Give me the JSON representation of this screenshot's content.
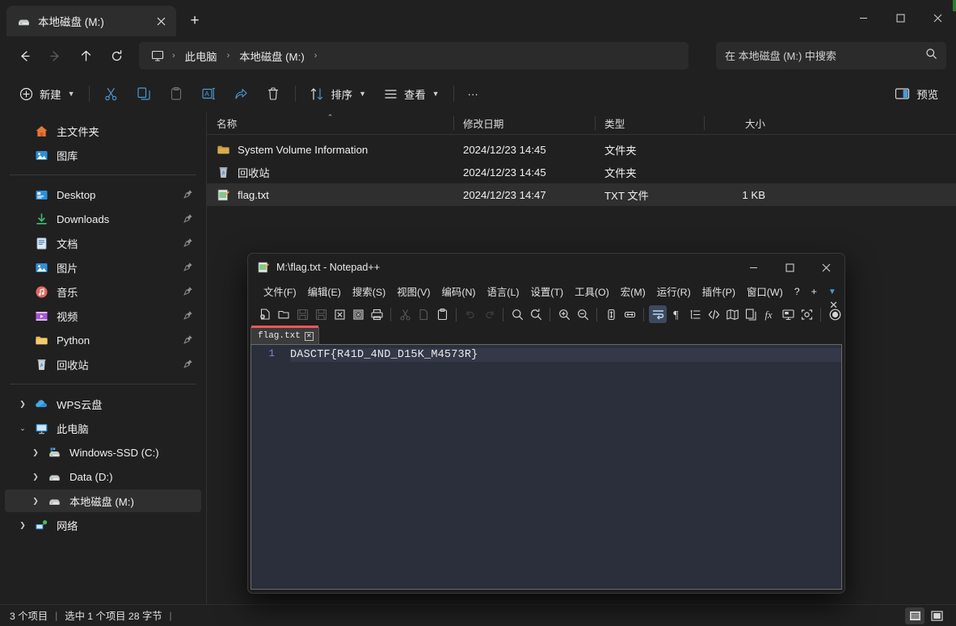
{
  "explorer": {
    "tab": {
      "label": "本地磁盘 (M:)",
      "icon": "drive-icon",
      "close_label": "✕"
    },
    "new_tab_label": "+",
    "window_controls": {
      "minimize": "minimize-icon",
      "maximize": "maximize-icon",
      "close": "close-icon"
    },
    "nav": {
      "back": "back-arrow-icon",
      "forward": "forward-arrow-icon",
      "up": "up-arrow-icon",
      "refresh": "refresh-icon"
    },
    "breadcrumb": {
      "root_icon": "this-pc-icon",
      "items": [
        "此电脑",
        "本地磁盘 (M:)"
      ],
      "separator": "›"
    },
    "search": {
      "placeholder": "在 本地磁盘 (M:) 中搜索",
      "value": "",
      "icon": "search-icon"
    },
    "commandbar": {
      "new_label": "新建",
      "cut_label": "剪切",
      "copy_label": "复制",
      "paste_label": "粘贴",
      "rename_label": "重命名",
      "share_label": "共享",
      "delete_label": "删除",
      "sort_label": "排序",
      "view_label": "查看",
      "more_label": "···",
      "preview_label": "预览"
    },
    "sidebar": {
      "top": [
        {
          "label": "主文件夹",
          "icon": "home-icon",
          "indent": 1,
          "expandable": false,
          "pinned": false
        },
        {
          "label": "图库",
          "icon": "gallery-icon",
          "indent": 1,
          "expandable": false,
          "pinned": false
        }
      ],
      "quick": [
        {
          "label": "Desktop",
          "icon": "desktop-icon",
          "indent": 1,
          "pinned": true
        },
        {
          "label": "Downloads",
          "icon": "downloads-icon",
          "indent": 1,
          "pinned": true
        },
        {
          "label": "文档",
          "icon": "documents-icon",
          "indent": 1,
          "pinned": true
        },
        {
          "label": "图片",
          "icon": "pictures-icon",
          "indent": 1,
          "pinned": true
        },
        {
          "label": "音乐",
          "icon": "music-icon",
          "indent": 1,
          "pinned": true
        },
        {
          "label": "视频",
          "icon": "videos-icon",
          "indent": 1,
          "pinned": true
        },
        {
          "label": "Python",
          "icon": "folder-icon",
          "indent": 1,
          "pinned": true
        },
        {
          "label": "回收站",
          "icon": "recycle-bin-icon",
          "indent": 1,
          "pinned": true
        }
      ],
      "tree": [
        {
          "label": "WPS云盘",
          "icon": "wps-cloud-icon",
          "indent": 0,
          "arrow": "collapsed",
          "selected": false
        },
        {
          "label": "此电脑",
          "icon": "this-pc-icon",
          "indent": 0,
          "arrow": "expanded",
          "selected": false
        },
        {
          "label": "Windows-SSD (C:)",
          "icon": "system-drive-icon",
          "indent": 2,
          "arrow": "collapsed",
          "selected": false
        },
        {
          "label": "Data (D:)",
          "icon": "drive-icon",
          "indent": 2,
          "arrow": "collapsed",
          "selected": false
        },
        {
          "label": "本地磁盘 (M:)",
          "icon": "drive-icon",
          "indent": 2,
          "arrow": "collapsed",
          "selected": true
        },
        {
          "label": "网络",
          "icon": "network-icon",
          "indent": 0,
          "arrow": "collapsed",
          "selected": false
        }
      ]
    },
    "filelist": {
      "columns": [
        "名称",
        "修改日期",
        "类型",
        "大小"
      ],
      "sort_column": "名称",
      "sort_direction": "asc",
      "rows": [
        {
          "name": "System Volume Information",
          "date": "2024/12/23 14:45",
          "type": "文件夹",
          "size": "",
          "icon": "folder-icon",
          "selected": false
        },
        {
          "name": "回收站",
          "date": "2024/12/23 14:45",
          "type": "文件夹",
          "size": "",
          "icon": "recycle-bin-icon",
          "selected": false
        },
        {
          "name": "flag.txt",
          "date": "2024/12/23 14:47",
          "type": "TXT 文件",
          "size": "1 KB",
          "icon": "notepadpp-file-icon",
          "selected": true
        }
      ]
    },
    "statusbar": {
      "items_count": "3 个项目",
      "selection": "选中 1 个项目  28 字节",
      "separator": "|",
      "view_details_icon": "details-view-icon",
      "view_icons_icon": "large-icons-view-icon"
    }
  },
  "notepadpp": {
    "title": "M:\\flag.txt - Notepad++",
    "title_icon": "notepadpp-icon",
    "window_controls": {
      "minimize": "minimize-icon",
      "maximize": "maximize-icon",
      "close": "close-icon"
    },
    "menu": [
      "文件(F)",
      "编辑(E)",
      "搜索(S)",
      "视图(V)",
      "编码(N)",
      "语言(L)",
      "设置(T)",
      "工具(O)",
      "宏(M)",
      "运行(R)",
      "插件(P)",
      "窗口(W)",
      "?",
      "+"
    ],
    "menu_caret": "▼",
    "toolbar_overflow": "»",
    "toolbar_close": "✕",
    "tab": {
      "label": "flag.txt",
      "close": "✕"
    },
    "editor": {
      "line_numbers": [
        "1"
      ],
      "lines": [
        "DASCTF{R41D_4ND_D15K_M4573R}"
      ]
    }
  },
  "colors": {
    "accent": "#4a9ad4",
    "tab_accent": "#f2565c",
    "explorer_bg": "#202020",
    "editor_bg": "#2b2f3b",
    "selection_bg": "#2f2f2f",
    "line_number": "#8a7fd4"
  }
}
